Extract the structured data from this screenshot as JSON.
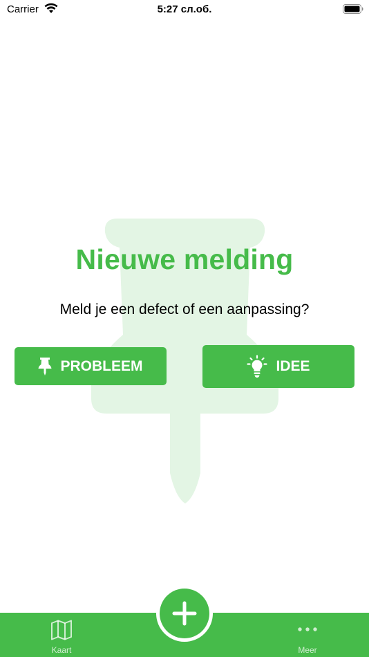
{
  "status_bar": {
    "carrier": "Carrier",
    "time": "5:27 сл.об."
  },
  "main": {
    "title": "Nieuwe melding",
    "subtitle": "Meld je een defect of een aanpassing?",
    "buttons": [
      {
        "label": "PROBLEEM",
        "icon": "pushpin-icon"
      },
      {
        "label": "IDEE",
        "icon": "lightbulb-icon"
      }
    ],
    "background_icon": "pushpin-watermark"
  },
  "tab_bar": {
    "items": [
      {
        "label": "Kaart",
        "icon": "map-icon"
      },
      {
        "label": "Meer",
        "icon": "more-icon"
      }
    ],
    "add_icon": "plus-icon"
  },
  "colors": {
    "accent": "#46bb4a",
    "watermark": "#e3f5e4",
    "background": "#ffffff"
  }
}
